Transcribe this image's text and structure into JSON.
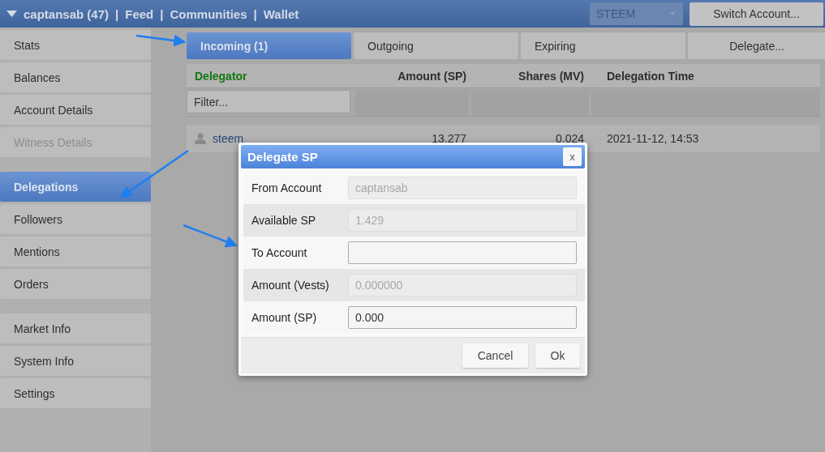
{
  "header": {
    "account": "captansab (47)",
    "separator": "|",
    "links": [
      "Feed",
      "Communities",
      "Wallet"
    ],
    "chain_select": "STEEM",
    "switch_button": "Switch Account..."
  },
  "sidebar": {
    "groups": [
      [
        {
          "label": "Stats",
          "selected": false,
          "disabled": false
        },
        {
          "label": "Balances",
          "selected": false,
          "disabled": false
        },
        {
          "label": "Account Details",
          "selected": false,
          "disabled": false
        },
        {
          "label": "Witness Details",
          "selected": false,
          "disabled": true
        }
      ],
      [
        {
          "label": "Delegations",
          "selected": true,
          "disabled": false
        },
        {
          "label": "Followers",
          "selected": false,
          "disabled": false
        },
        {
          "label": "Mentions",
          "selected": false,
          "disabled": false
        },
        {
          "label": "Orders",
          "selected": false,
          "disabled": false
        }
      ],
      [
        {
          "label": "Market Info",
          "selected": false,
          "disabled": false
        },
        {
          "label": "System Info",
          "selected": false,
          "disabled": false
        },
        {
          "label": "Settings",
          "selected": false,
          "disabled": false
        }
      ]
    ]
  },
  "tabs": [
    {
      "label": "Incoming (1)",
      "selected": true
    },
    {
      "label": "Outgoing",
      "selected": false
    },
    {
      "label": "Expiring",
      "selected": false
    }
  ],
  "delegate_button": "Delegate...",
  "table": {
    "columns": [
      {
        "label": "Delegator",
        "sorted": true
      },
      {
        "label": "Amount (SP)",
        "sorted": false
      },
      {
        "label": "Shares (MV)",
        "sorted": false
      },
      {
        "label": "Delegation Time",
        "sorted": false
      }
    ],
    "filter_placeholder": "Filter...",
    "rows": [
      {
        "delegator": "steem",
        "amount": "13.277",
        "shares": "0.024",
        "time": "2021-11-12, 14:53"
      }
    ]
  },
  "dialog": {
    "title": "Delegate SP",
    "close": "x",
    "fields": [
      {
        "label": "From Account",
        "value": "captansab",
        "disabled": true
      },
      {
        "label": "Available SP",
        "value": "1.429",
        "disabled": true
      },
      {
        "label": "To Account",
        "disabled": false
      },
      {
        "label": "Amount (Vests)",
        "value": "0.000000",
        "disabled": true
      },
      {
        "label": "Amount (SP)",
        "value": "0.000",
        "disabled": false
      }
    ],
    "buttons": [
      "Cancel",
      "Ok"
    ]
  }
}
